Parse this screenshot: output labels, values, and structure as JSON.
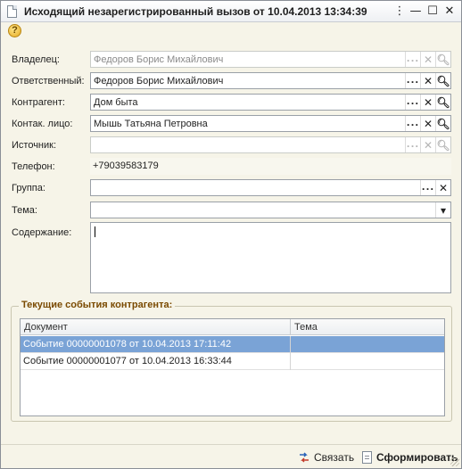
{
  "window": {
    "title": "Исходящий незарегистрированный вызов от 10.04.2013 13:34:39",
    "menu_glyph": "⋮",
    "minimize_glyph": "—",
    "maximize_glyph": "☐",
    "close_glyph": "✕"
  },
  "toolbar": {
    "help_glyph": "?"
  },
  "form": {
    "owner": {
      "label": "Владелец:",
      "value": "Федоров Борис Михайлович",
      "disabled": true
    },
    "responsible": {
      "label": "Ответственный:",
      "value": "Федоров Борис Михайлович"
    },
    "counterparty": {
      "label": "Контрагент:",
      "value": "Дом быта"
    },
    "contact": {
      "label": "Контак. лицо:",
      "value": "Мышь Татьяна Петровна"
    },
    "source": {
      "label": "Источник:",
      "value": "",
      "disabled": true
    },
    "phone": {
      "label": "Телефон:",
      "value": "+79039583179"
    },
    "group": {
      "label": "Группа:",
      "value": ""
    },
    "topic": {
      "label": "Тема:",
      "value": ""
    },
    "content": {
      "label": "Содержание:",
      "value": ""
    }
  },
  "glyphs": {
    "select": "...",
    "clear": "✕",
    "search": "🔍︎",
    "dropdown": "▾"
  },
  "events": {
    "title": "Текущие события контрагента:",
    "columns": [
      "Документ",
      "Тема"
    ],
    "rows": [
      {
        "document": "Событие 00000001078 от 10.04.2013 17:11:42",
        "topic": "",
        "selected": true
      },
      {
        "document": "Событие 00000001077 от 10.04.2013 16:33:44",
        "topic": ""
      }
    ]
  },
  "footer": {
    "link_label": "Связать",
    "generate_label": "Сформировать"
  },
  "colors": {
    "selection": "#7aa3d6",
    "group_title": "#7a4a00",
    "window_bg": "#f6f4e8"
  }
}
